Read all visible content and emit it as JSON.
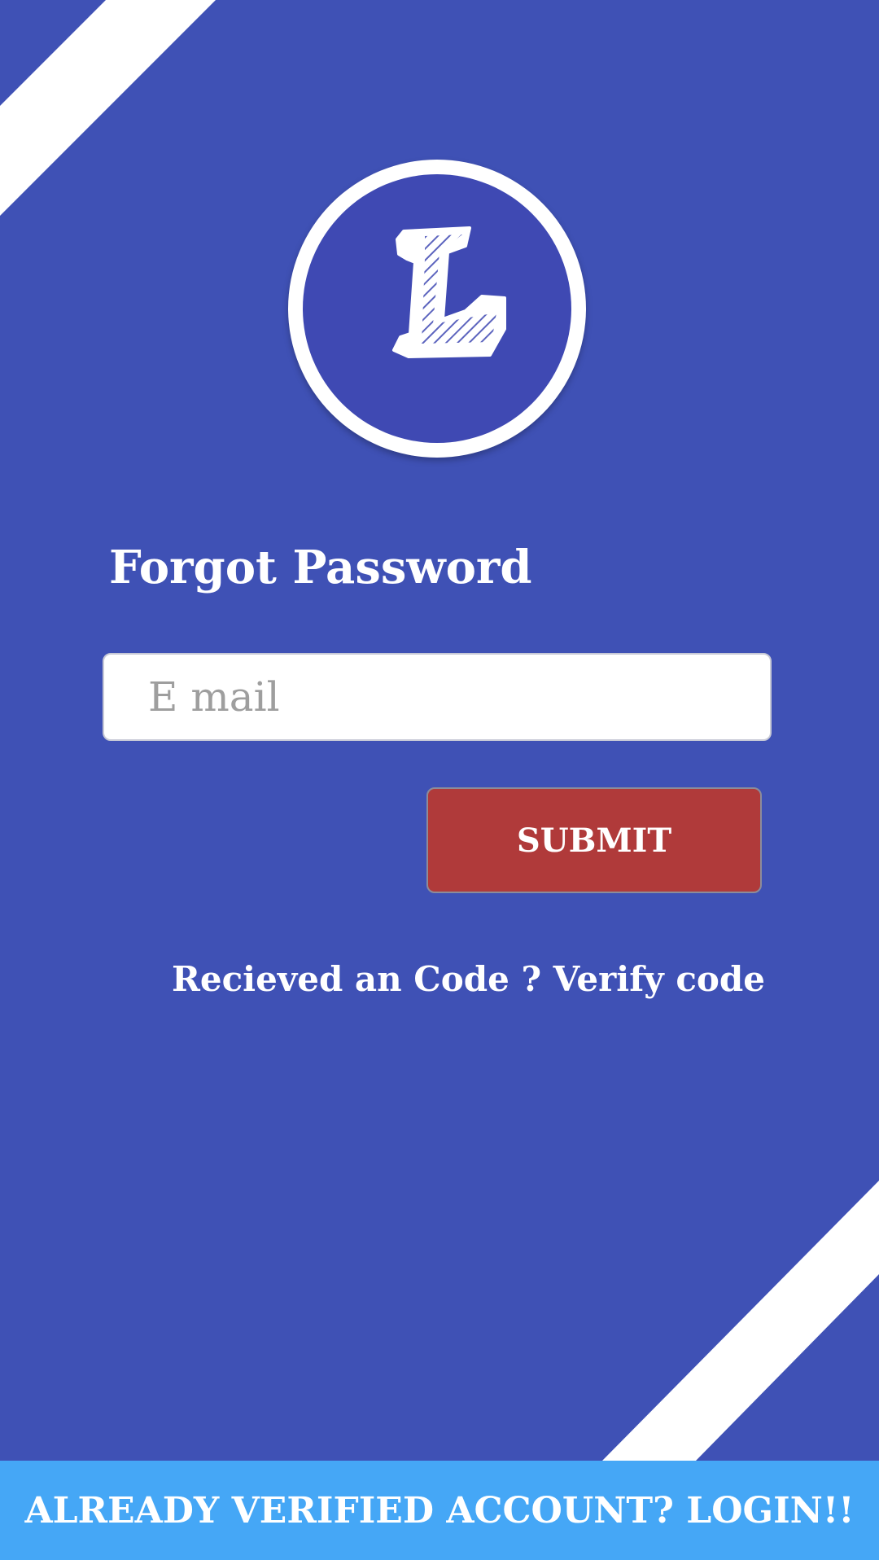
{
  "colors": {
    "background": "#3f51b5",
    "accent_submit": "#b03a3a",
    "bottom_bar": "#45a7f6",
    "text": "#ffffff"
  },
  "logo": {
    "letter_icon": "letter-l-logo-icon"
  },
  "form": {
    "title": "Forgot Password",
    "email_placeholder": "E mail",
    "email_value": "",
    "submit_label": "SUBMIT",
    "verify_link": "Recieved an Code ? Verify code"
  },
  "footer": {
    "login_label": "ALREADY VERIFIED ACCOUNT? LOGIN!!"
  }
}
